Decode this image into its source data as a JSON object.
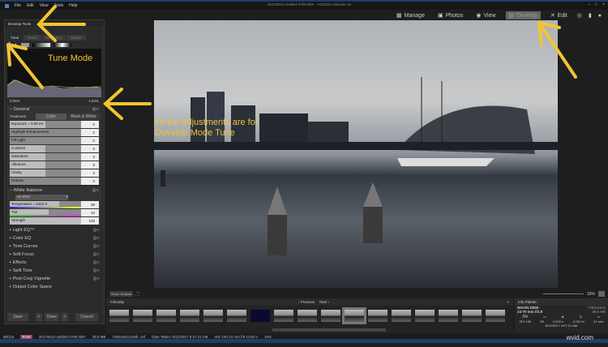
{
  "menu": [
    "File",
    "Edit",
    "View",
    "Tools",
    "Help"
  ],
  "window_title": "20170612-untitled-3759.NEF - ACDSee Ultimate 10",
  "modes": [
    {
      "icon": "grid-icon",
      "label": "Manage"
    },
    {
      "icon": "photos-icon",
      "label": "Photos"
    },
    {
      "icon": "eye-icon",
      "label": "View"
    },
    {
      "icon": "develop-icon",
      "label": "Develop",
      "active": true
    },
    {
      "icon": "edit-icon",
      "label": "Edit"
    }
  ],
  "panel": {
    "title": "Develop Tools",
    "tabs": [
      "Tune",
      "Detail",
      "Geometry",
      "Repair"
    ],
    "hist_left": "0.06%",
    "hist_right": "4.62%"
  },
  "general": {
    "title": "General",
    "treatment_label": "Treatment",
    "color": "Color",
    "bw": "Black & White",
    "sliders": [
      {
        "label": "Exposure = 0.00 eV",
        "value": "0",
        "pos": 0.5
      },
      {
        "label": "Highlight Enhancement",
        "value": "0",
        "pos": 0
      },
      {
        "label": "Fill Light",
        "value": "0",
        "pos": 0
      },
      {
        "label": "Contrast",
        "value": "0",
        "pos": 0.5
      },
      {
        "label": "Saturation",
        "value": "0",
        "pos": 0.5
      },
      {
        "label": "Vibrance",
        "value": "0",
        "pos": 0.5
      },
      {
        "label": "Clarity",
        "value": "0",
        "pos": 0.5
      },
      {
        "label": "Dehaze",
        "value": "0",
        "pos": 0
      }
    ]
  },
  "white_balance": {
    "title": "White Balance",
    "preset": "As Shot",
    "sliders": [
      {
        "label": "Temperature = 6310 K",
        "value": "38",
        "pos": 0.69
      },
      {
        "label": "Tint",
        "value": "10",
        "pos": 0.55
      },
      {
        "label": "Strength",
        "value": "100",
        "pos": 1
      }
    ]
  },
  "groups": [
    "Light EQ™",
    "Color EQ",
    "Tone Curves",
    "Soft Focus",
    "Effects",
    "Split Tone",
    "Post-Crop Vignette",
    "Output Color Space"
  ],
  "buttons": {
    "save": "Save",
    "done": "Done",
    "cancel": "Cancel"
  },
  "annotations": {
    "tune": "Tune Mode",
    "adjust1": "where the adjustments are for",
    "adjust2": "the Develop Mode Tune"
  },
  "viewer": {
    "show_original": "Show Original",
    "zoom": "16%"
  },
  "filmstrip": {
    "title": "Filmstrip",
    "previous": "Previous",
    "next": "Next"
  },
  "info": {
    "title": "Info Palette",
    "camera": "NIKON D800",
    "lens": "24-70 mm f/2.8",
    "dims": "7360x4912",
    "size": "39.5 MB",
    "mode": "Av",
    "iso": "ISO 100",
    "fstop": "f/8",
    "shutter": "1/100 s",
    "ev": "-0.33 eV",
    "focal": "24 mm",
    "date": "6/12/2017 9:27:21 AM"
  },
  "status": [
    "86/116",
    "RAW",
    "20170612-untitled-3759.NEF",
    "39.5 MB",
    "7360x4912x48b .nef",
    "Date Taken: 6/12/2017 9:27:21 AM",
    "ISO 100   24 mm   f/8   1/100 s",
    "16%"
  ],
  "watermark": "wvid.com",
  "colors": {
    "accent": "#f2c530",
    "titlebar": "#1f3d6b"
  }
}
